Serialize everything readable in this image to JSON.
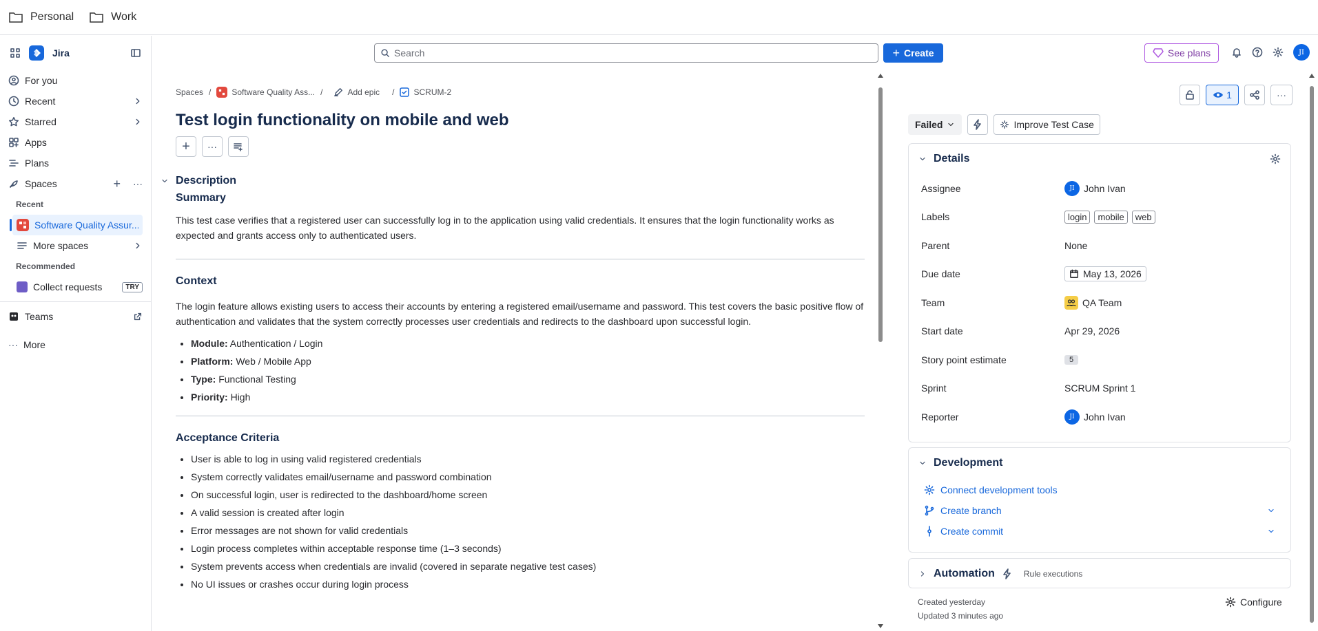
{
  "bookmarks": [
    {
      "label": "Personal"
    },
    {
      "label": "Work"
    }
  ],
  "sidebar": {
    "brand": "Jira",
    "items": [
      {
        "label": "For you"
      },
      {
        "label": "Recent"
      },
      {
        "label": "Starred"
      },
      {
        "label": "Apps"
      },
      {
        "label": "Plans"
      },
      {
        "label": "Spaces"
      }
    ],
    "recent_label": "Recent",
    "active_space": "Software Quality Assur...",
    "more_spaces": "More spaces",
    "recommended_label": "Recommended",
    "collect_requests": "Collect requests",
    "try_badge": "TRY",
    "teams": "Teams",
    "more": "More"
  },
  "topbar": {
    "search_placeholder": "Search",
    "create_label": "Create",
    "see_plans_label": "See plans",
    "avatar_initials": "JI"
  },
  "breadcrumb": {
    "spaces": "Spaces",
    "project": "Software Quality Ass...",
    "add_epic": "Add epic",
    "issue_key": "SCRUM-2"
  },
  "issue": {
    "title": "Test login functionality on mobile and web",
    "description_label": "Description",
    "summary_heading": "Summary",
    "summary_text": "This test case verifies that a registered user can successfully log in to the application using valid credentials. It ensures that the login functionality works as expected and grants access only to authenticated users.",
    "context_heading": "Context",
    "context_text": "The login feature allows existing users to access their accounts by entering a registered email/username and password. This test covers the basic positive flow of authentication and validates that the system correctly processes user credentials and redirects to the dashboard upon successful login.",
    "context_items": [
      {
        "key": "Module:",
        "value": "Authentication / Login"
      },
      {
        "key": "Platform:",
        "value": "Web / Mobile App"
      },
      {
        "key": "Type:",
        "value": "Functional Testing"
      },
      {
        "key": "Priority:",
        "value": "High"
      }
    ],
    "criteria_heading": "Acceptance Criteria",
    "criteria": [
      "User is able to log in using valid registered credentials",
      "System correctly validates email/username and password combination",
      "On successful login, user is redirected to the dashboard/home screen",
      "A valid session is created after login",
      "Error messages are not shown for valid credentials",
      "Login process completes within acceptable response time (1–3 seconds)",
      "System prevents access when credentials are invalid (covered in separate negative test cases)",
      "No UI issues or crashes occur during login process"
    ]
  },
  "panel": {
    "watch_count": "1",
    "status": "Failed",
    "improve_label": "Improve Test Case",
    "details_label": "Details",
    "fields": {
      "assignee_label": "Assignee",
      "assignee": "John Ivan",
      "assignee_initials": "JI",
      "labels_label": "Labels",
      "labels": [
        "login",
        "mobile",
        "web"
      ],
      "parent_label": "Parent",
      "parent": "None",
      "due_label": "Due date",
      "due": "May 13, 2026",
      "team_label": "Team",
      "team": "QA Team",
      "start_label": "Start date",
      "start": "Apr 29, 2026",
      "sp_label": "Story point estimate",
      "sp": "5",
      "sprint_label": "Sprint",
      "sprint": "SCRUM Sprint 1",
      "reporter_label": "Reporter",
      "reporter": "John Ivan",
      "reporter_initials": "JI"
    },
    "development_label": "Development",
    "connect_tools": "Connect development tools",
    "create_branch": "Create branch",
    "create_commit": "Create commit",
    "automation_label": "Automation",
    "rule_executions": "Rule executions",
    "created": "Created yesterday",
    "updated": "Updated 3 minutes ago",
    "configure": "Configure"
  },
  "colors": {
    "accent": "#1868db",
    "plans": "#803fa5",
    "space": "#e2483d"
  }
}
